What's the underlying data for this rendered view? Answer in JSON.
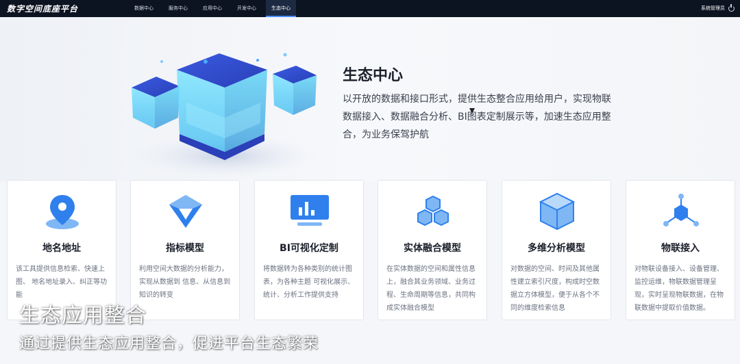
{
  "app": {
    "title": "数字空间底座平台"
  },
  "nav": {
    "items": [
      {
        "label": "数据中心",
        "active": false
      },
      {
        "label": "服务中心",
        "active": false
      },
      {
        "label": "应用中心",
        "active": false
      },
      {
        "label": "开发中心",
        "active": false
      },
      {
        "label": "生态中心",
        "active": true
      }
    ]
  },
  "user": {
    "name": "系统管理员",
    "icon": "power-icon"
  },
  "hero": {
    "title": "生态中心",
    "description": "以开放的数据和接口形式，提供生态整合应用给用户，实现物联数据接入、数据融合分析、BI图表定制展示等，加速生态应用整合，为业务保驾护航"
  },
  "cards": [
    {
      "title": "地名地址",
      "icon": "map-pin-icon",
      "description": "该工具提供信息检索、快速上图、 地名地址录入、纠正等功能"
    },
    {
      "title": "指标模型",
      "icon": "funnel-cube-icon",
      "description": "利用空间大数据的分析能力，实现从数据到 信息、从信息到知识的转变"
    },
    {
      "title": "BI可视化定制",
      "icon": "bar-chart-monitor-icon",
      "description": "将数据转为各种类别的统计图表，为各种主题 可视化展示、统计、分析工作提供支持"
    },
    {
      "title": "实体融合模型",
      "icon": "stacked-cubes-icon",
      "description": "在实体数据的空间和属性信息上，融合其业务领域、业务过程、生命周期等信息，共同构成实体融合模型"
    },
    {
      "title": "多维分析模型",
      "icon": "3d-cube-icon",
      "description": "对数据的空间、时间及其他属性建立索引尺度，构成时空数据立方体模型，便于从各个不同的维度检索信息"
    },
    {
      "title": "物联接入",
      "icon": "iot-network-icon",
      "description": "对物联设备接入、设备管理、监控运维，物联数据管理呈现，实时呈现物联数据，在物联数据中提取价值数据。"
    }
  ],
  "caption": {
    "title": "生态应用整合",
    "subtitle": "通过提供生态应用整合，促进平台生态繁荣"
  },
  "colors": {
    "accent": "#2f80ed",
    "topbar": "#0d1421",
    "icon_blue": "#3b8ef0"
  }
}
